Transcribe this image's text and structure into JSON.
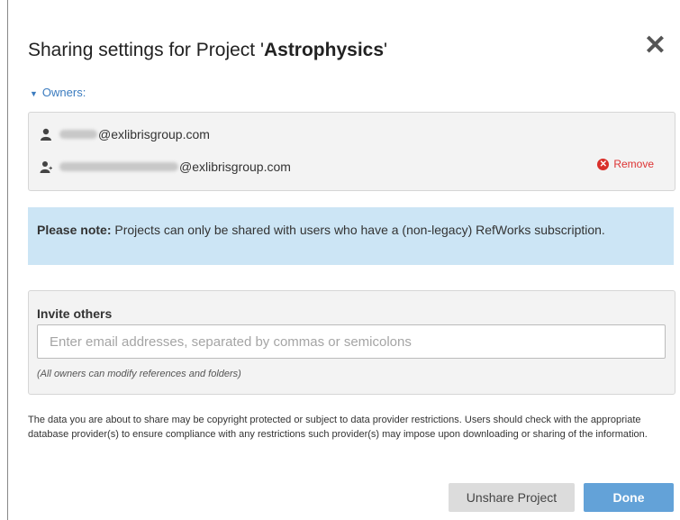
{
  "dialog": {
    "title_prefix": "Sharing settings for Project '",
    "project_name": "Astrophysics",
    "title_suffix": "'",
    "close_glyph": "✕"
  },
  "owners": {
    "toggle_label": "Owners:",
    "items": [
      {
        "email_suffix": "@exlibrisgroup.com",
        "icon": "user-icon",
        "removable": false
      },
      {
        "email_suffix": "@exlibrisgroup.com",
        "icon": "add-user-icon",
        "removable": true,
        "remove_label": "Remove"
      }
    ]
  },
  "note": {
    "bold": "Please note:",
    "text": " Projects can only be shared with users who have a (non-legacy) RefWorks subscription."
  },
  "invite": {
    "label": "Invite others",
    "placeholder": "Enter email addresses, separated by commas or semicolons",
    "value": "",
    "hint": "(All owners can modify references and folders)"
  },
  "disclaimer": "The data you are about to share may be copyright protected or subject to data provider restrictions. Users should check with the appropriate database provider(s) to ensure compliance with any restrictions such provider(s) may impose upon downloading or sharing of the information.",
  "buttons": {
    "unshare": "Unshare Project",
    "done": "Done"
  },
  "colors": {
    "accent": "#3a7bbf",
    "note_bg": "#cce5f5",
    "remove": "#d9302a",
    "done_bg": "#63a2d8"
  }
}
